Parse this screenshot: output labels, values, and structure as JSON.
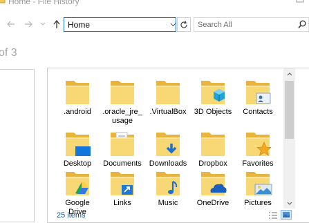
{
  "window": {
    "title": "Home - File History"
  },
  "nav": {
    "address": "Home",
    "search_placeholder": "Search All"
  },
  "pager": {
    "text": "of 3"
  },
  "items": [
    {
      "label": "android",
      "display": ".android",
      "type": "folder"
    },
    {
      "label": ".oracle_jre_usage",
      "display": ".oracle_jre_ usage",
      "type": "folder"
    },
    {
      "label": ".VirtualBox",
      "type": "folder"
    },
    {
      "label": "3D Objects",
      "type": "folder-3d"
    },
    {
      "label": "Contacts",
      "type": "folder-contacts"
    },
    {
      "label": "Desktop",
      "type": "folder-desktop"
    },
    {
      "label": "Documents",
      "type": "folder-documents"
    },
    {
      "label": "Downloads",
      "type": "folder-downloads"
    },
    {
      "label": "Dropbox",
      "type": "folder"
    },
    {
      "label": "Favorites",
      "type": "folder-favorites"
    },
    {
      "label": "Google Drive",
      "type": "folder-gdrive"
    },
    {
      "label": "Links",
      "type": "folder-links"
    },
    {
      "label": "Music",
      "type": "folder-music"
    },
    {
      "label": "OneDrive",
      "type": "folder-onedrive"
    },
    {
      "label": "Pictures",
      "type": "folder-pictures"
    }
  ],
  "status": {
    "count": "25 items"
  },
  "colors": {
    "folder": "#f8d775",
    "folder_dark": "#e8b53c",
    "accent": "#1e6fcf"
  }
}
